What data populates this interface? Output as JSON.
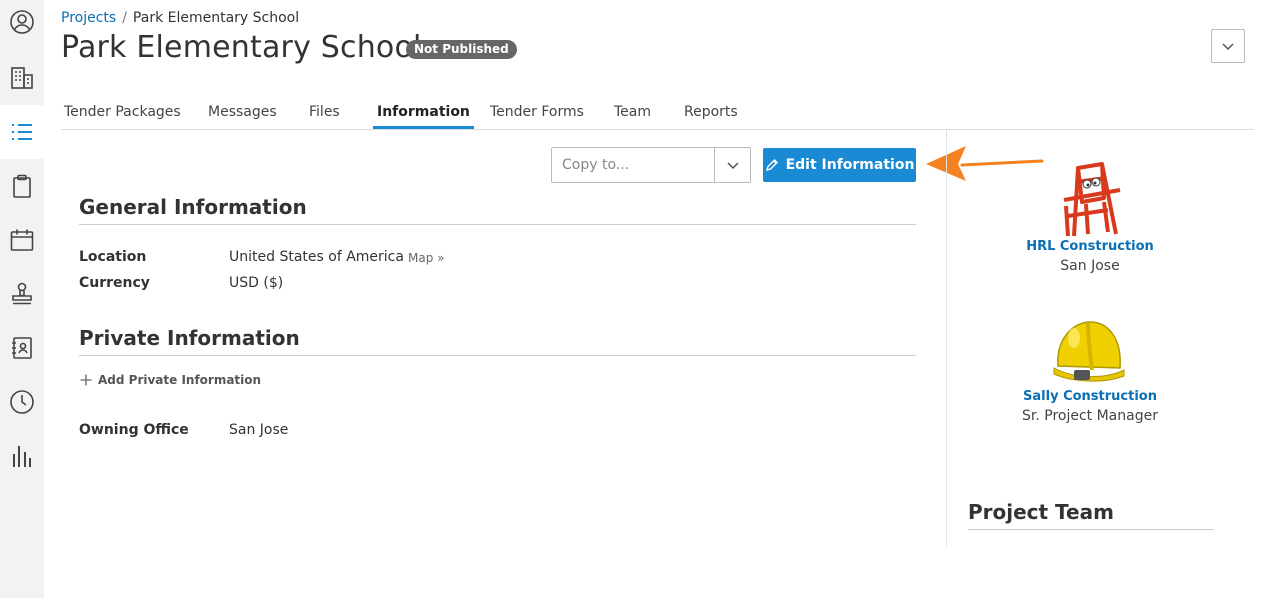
{
  "sidebar": {
    "items": [
      {
        "icon": "user-circle-icon"
      },
      {
        "icon": "building-icon"
      },
      {
        "icon": "list-icon",
        "active": true
      },
      {
        "icon": "clipboard-icon"
      },
      {
        "icon": "calendar-icon"
      },
      {
        "icon": "stamp-icon"
      },
      {
        "icon": "address-book-icon"
      },
      {
        "icon": "clock-icon"
      },
      {
        "icon": "bar-chart-icon"
      }
    ]
  },
  "breadcrumb": {
    "root": "Projects",
    "separator": "/",
    "current": "Park Elementary School"
  },
  "header": {
    "title": "Park Elementary School",
    "status": "Not Published"
  },
  "tabs": [
    "Tender Packages",
    "Messages",
    "Files",
    "Information",
    "Tender Forms",
    "Team",
    "Reports"
  ],
  "active_tab": "Information",
  "toolbar": {
    "copy_placeholder": "Copy to...",
    "edit_label": "Edit Information"
  },
  "general": {
    "title": "General Information",
    "location_label": "Location",
    "location_value": "United States of America",
    "map_link": "Map »",
    "currency_label": "Currency",
    "currency_value": "USD ($)"
  },
  "private": {
    "title": "Private Information",
    "add_label": "Add Private Information",
    "owning_office_label": "Owning Office",
    "owning_office_value": "San Jose"
  },
  "companies": [
    {
      "name": "HRL Construction",
      "sub": "San Jose"
    },
    {
      "name": "Sally Construction",
      "sub": "Sr. Project Manager"
    }
  ],
  "project_team": {
    "title": "Project Team"
  },
  "colors": {
    "accent": "#1a8ad4",
    "link": "#0a6eb4",
    "arrow": "#f5821f",
    "badge": "#666666",
    "sidebar": "#f2f2f2"
  }
}
